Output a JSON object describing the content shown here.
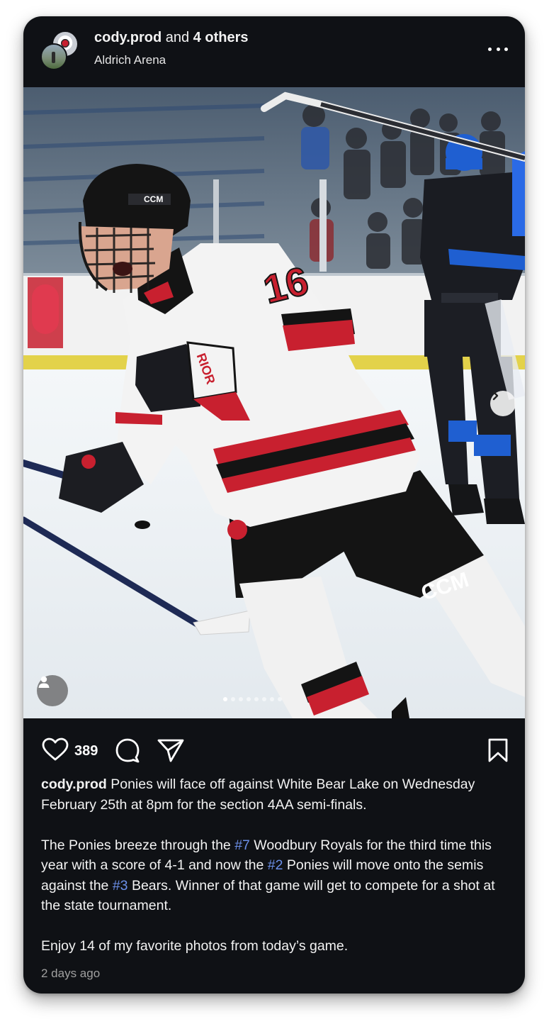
{
  "header": {
    "author": "cody.prod",
    "coauthors_text": " and ",
    "coauthors_count": "4 others",
    "location": "Aldrich Arena",
    "more_icon": "more-horizontal-icon"
  },
  "photo": {
    "jersey_number": "16",
    "helmet_brand": "CCM",
    "pants_brand": "CCM",
    "carousel_total": 14,
    "carousel_active": 1,
    "icons": {
      "next": "chevron-right-icon",
      "tag": "user-tag-icon"
    },
    "colors": {
      "jersey_red": "#c8202f",
      "ice": "#eef3f6",
      "boards_yellow": "#e8d400",
      "opponent_blue": "#1f5fd1"
    }
  },
  "actions": {
    "like_count": "389",
    "icons": {
      "like": "heart-icon",
      "comment": "comment-icon",
      "share": "send-icon",
      "save": "bookmark-icon"
    }
  },
  "caption": {
    "username": "cody.prod",
    "p1_text": " Ponies will face off against White Bear Lake on Wednesday February 25th at 8pm for the section 4AA semi-finals.",
    "p2_a": "The Ponies breeze through the ",
    "p2_tag1": "#7",
    "p2_b": " Woodbury Royals for the third time this year with a score of 4-1 and now the ",
    "p2_tag2": "#2",
    "p2_c": " Ponies will move onto the semis against the ",
    "p2_tag3": "#3",
    "p2_d": " Bears. Winner of that game will get to compete for a shot at the state tournament.",
    "p3_text": "Enjoy 14 of my favorite photos from today’s game.",
    "link_color": "#6b8fe8"
  },
  "timestamp": "2 days ago"
}
